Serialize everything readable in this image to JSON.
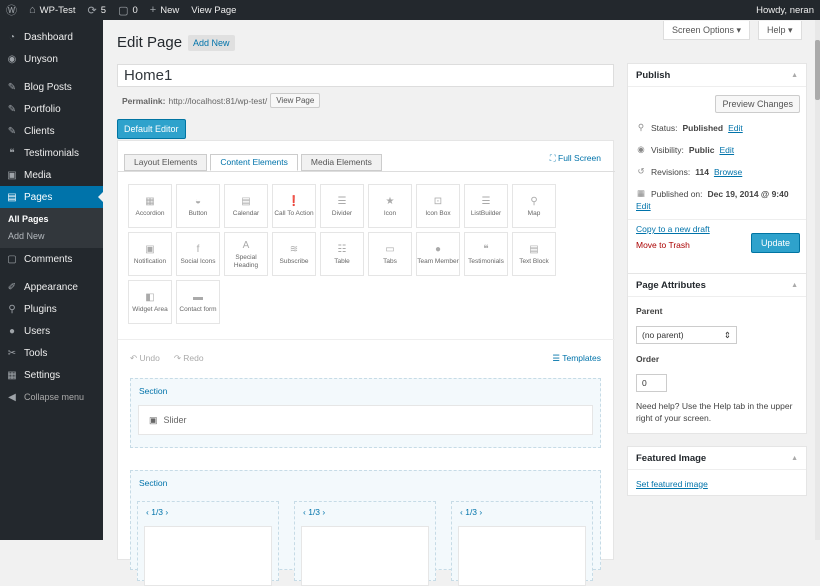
{
  "adminbar": {
    "site": "WP-Test",
    "updates": "5",
    "comments": "0",
    "new": "New",
    "view": "View Page",
    "howdy": "Howdy, neran"
  },
  "menu": {
    "items": [
      {
        "label": "Dashboard",
        "icon": "dashboard-icon"
      },
      {
        "label": "Unyson",
        "icon": "unyson-icon"
      },
      {
        "label": "Blog Posts",
        "icon": "pin-icon"
      },
      {
        "label": "Portfolio",
        "icon": "portfolio-icon"
      },
      {
        "label": "Clients",
        "icon": "clients-icon"
      },
      {
        "label": "Testimonials",
        "icon": "quote-icon"
      },
      {
        "label": "Media",
        "icon": "media-icon"
      },
      {
        "label": "Pages",
        "icon": "pages-icon"
      },
      {
        "label": "Comments",
        "icon": "comments-icon"
      },
      {
        "label": "Appearance",
        "icon": "brush-icon"
      },
      {
        "label": "Plugins",
        "icon": "plugin-icon"
      },
      {
        "label": "Users",
        "icon": "users-icon"
      },
      {
        "label": "Tools",
        "icon": "tools-icon"
      },
      {
        "label": "Settings",
        "icon": "settings-icon"
      },
      {
        "label": "Collapse menu",
        "icon": "collapse-icon"
      }
    ],
    "sub": [
      "All Pages",
      "Add New"
    ]
  },
  "header": {
    "title": "Edit Page",
    "add_new": "Add New",
    "screen_options": "Screen Options ▾",
    "help": "Help ▾"
  },
  "post": {
    "title": "Home1",
    "permalink_label": "Permalink:",
    "permalink_url": "http://localhost:81/wp-test/",
    "view_page": "View Page",
    "default_editor": "Default Editor"
  },
  "builder": {
    "tabs": [
      "Layout Elements",
      "Content Elements",
      "Media Elements"
    ],
    "full_screen": "Full Screen",
    "elements": [
      "Accordion",
      "Button",
      "Calendar",
      "Call To Action",
      "Divider",
      "Icon",
      "Icon Box",
      "ListBuilder",
      "Map",
      "Notification",
      "Social Icons",
      "Special Heading",
      "Subscribe",
      "Table",
      "Tabs",
      "Team Member",
      "Testimonials",
      "Text Block",
      "Widget Area",
      "Contact form"
    ],
    "undo": "Undo",
    "redo": "Redo",
    "templates": "Templates",
    "section1_label": "Section",
    "slider": "Slider",
    "section2_label": "Section",
    "col_label": "1/3"
  },
  "publish": {
    "title": "Publish",
    "preview": "Preview Changes",
    "status_label": "Status:",
    "status_value": "Published",
    "visibility_label": "Visibility:",
    "visibility_value": "Public",
    "revisions_label": "Revisions:",
    "revisions_value": "114",
    "browse": "Browse",
    "published_label": "Published on:",
    "published_value": "Dec 19, 2014 @ 9:40",
    "edit": "Edit",
    "copy": "Copy to a new draft",
    "trash": "Move to Trash",
    "update": "Update"
  },
  "attributes": {
    "title": "Page Attributes",
    "parent_label": "Parent",
    "parent_value": "(no parent)",
    "order_label": "Order",
    "order_value": "0",
    "help": "Need help? Use the Help tab in the upper right of your screen."
  },
  "featured": {
    "title": "Featured Image",
    "link": "Set featured image"
  }
}
